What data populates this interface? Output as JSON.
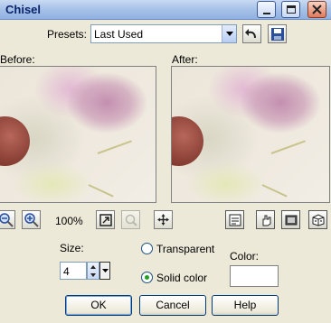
{
  "window": {
    "title": "Chisel",
    "controls": {
      "minimize": "minimize-icon",
      "maximize": "maximize-icon",
      "close": "close-icon"
    }
  },
  "presets": {
    "label": "Presets:",
    "value": "Last Used"
  },
  "preview": {
    "before_label": "Before:",
    "after_label": "After:"
  },
  "zoom": {
    "level": "100%"
  },
  "size": {
    "label": "Size:",
    "value": "4"
  },
  "background_mode": {
    "options": [
      {
        "label": "Transparent",
        "selected": false
      },
      {
        "label": "Solid color",
        "selected": true
      }
    ]
  },
  "color": {
    "label": "Color:",
    "value": "#ffffff"
  },
  "buttons": {
    "ok": "OK",
    "cancel": "Cancel",
    "help": "Help"
  }
}
